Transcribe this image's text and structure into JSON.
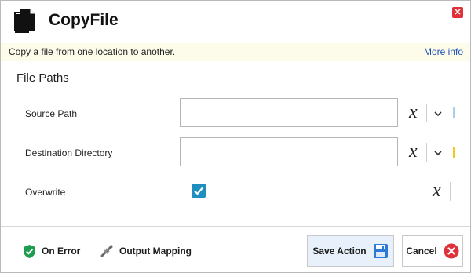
{
  "header": {
    "title": "CopyFile",
    "close_glyph": "✕"
  },
  "description": {
    "text": "Copy a file from one location to another.",
    "more_info": "More info"
  },
  "section": {
    "title": "File Paths"
  },
  "fields": {
    "source_path": {
      "label": "Source Path",
      "value": "",
      "indicator_color": "#a9cfe8"
    },
    "destination_directory": {
      "label": "Destination Directory",
      "value": "",
      "indicator_color": "#f5c518"
    },
    "overwrite": {
      "label": "Overwrite",
      "checked": true
    }
  },
  "variable_icon_glyph": "x",
  "footer": {
    "on_error": "On Error",
    "output_mapping": "Output Mapping",
    "save_action": "Save Action",
    "cancel": "Cancel"
  },
  "colors": {
    "accent": "#1e8fbf",
    "cancel_red": "#e0303a",
    "on_error_green": "#1f9d4e",
    "description_bg": "#fdfbe9"
  }
}
